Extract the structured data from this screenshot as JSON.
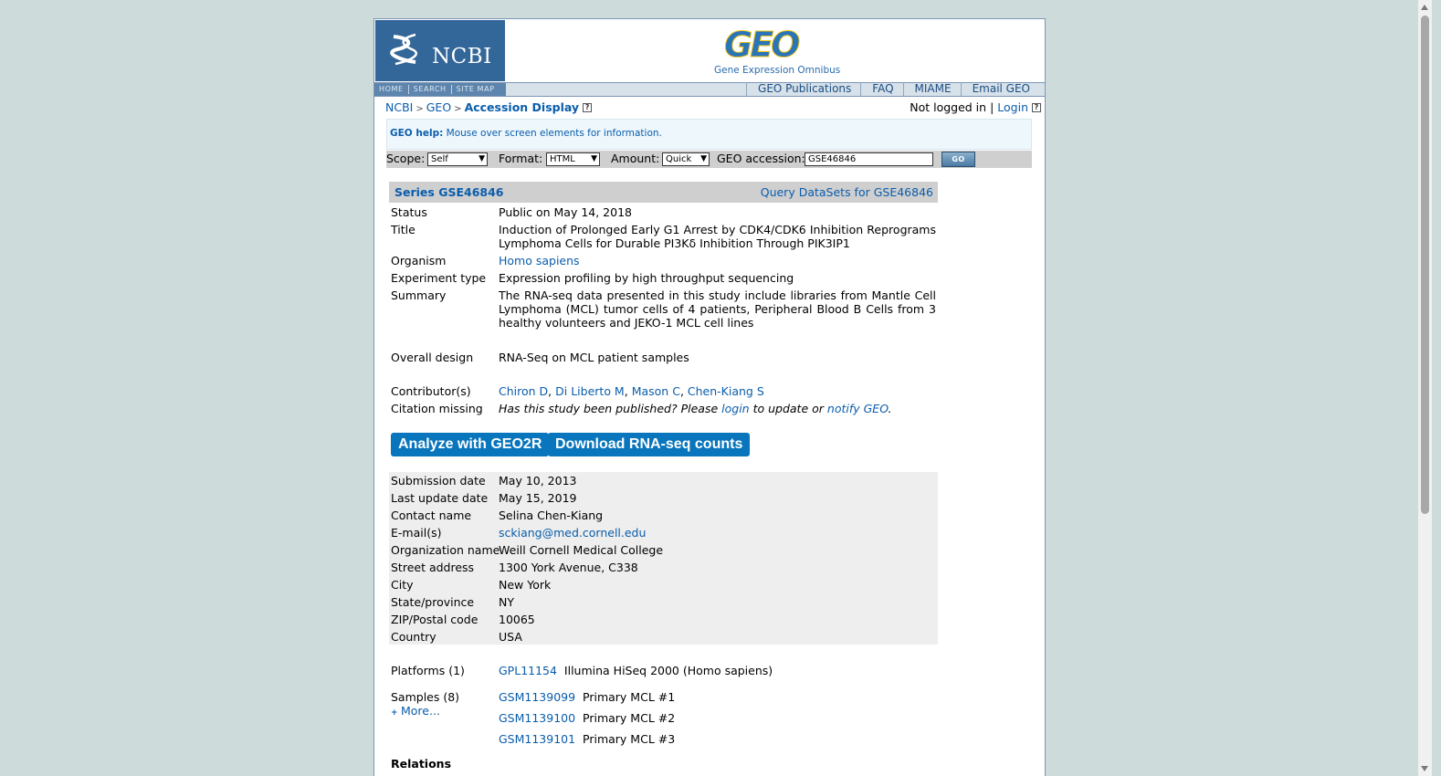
{
  "header": {
    "ncbi_logo_text": "NCBI",
    "geo_logo_text": "GEO",
    "geo_subtitle": "Gene Expression Omnibus",
    "ncbi_nav": [
      "HOME",
      "SEARCH",
      "SITE MAP"
    ],
    "geo_nav": [
      "GEO Publications",
      "FAQ",
      "MIAME",
      "Email GEO"
    ]
  },
  "breadcrumb": {
    "items": [
      "NCBI",
      "GEO"
    ],
    "current": "Accession Display",
    "sep": ">"
  },
  "login": {
    "status": "Not logged in",
    "separator": "|",
    "link": "Login"
  },
  "help": {
    "label": "GEO help:",
    "text": "Mouse over screen elements for information."
  },
  "query": {
    "scope_label": "Scope:",
    "scope_value": "Self",
    "format_label": "Format:",
    "format_value": "HTML",
    "amount_label": "Amount:",
    "amount_value": "Quick",
    "accession_label": "GEO accession:",
    "accession_value": "GSE46846",
    "go_label": "GO"
  },
  "series": {
    "title": "Series GSE46846",
    "query_link": "Query DataSets for GSE46846",
    "status_label": "Status",
    "status_value": "Public on May 14, 2018",
    "title_label": "Title",
    "title_value": "Induction of Prolonged Early G1 Arrest by CDK4/CDK6 Inhibition Reprograms Lymphoma Cells for Durable PI3Kδ Inhibition Through PIK3IP1",
    "organism_label": "Organism",
    "organism_value": "Homo sapiens",
    "exptype_label": "Experiment type",
    "exptype_value": "Expression profiling by high throughput sequencing",
    "summary_label": "Summary",
    "summary_value": "The RNA-seq data presented in this study include libraries from Mantle Cell Lymphoma (MCL) tumor cells of 4 patients, Peripheral Blood B Cells from 3 healthy volunteers and JEKO-1 MCL cell lines",
    "design_label": "Overall design",
    "design_value": "RNA-Seq on MCL patient samples",
    "contrib_label": "Contributor(s)",
    "contributors": [
      "Chiron D",
      "Di Liberto M",
      "Mason C",
      "Chen-Kiang S"
    ],
    "contrib_sep": ",",
    "citation_label": "Citation missing",
    "citation_text1": "Has this study been published? Please",
    "citation_login": "login",
    "citation_text2": "to update or",
    "citation_notify": "notify GEO",
    "citation_end": "."
  },
  "buttons": {
    "geo2r": "Analyze with GEO2R",
    "download": "Download RNA-seq counts"
  },
  "contact": {
    "submission_label": "Submission date",
    "submission_value": "May 10, 2013",
    "update_label": "Last update date",
    "update_value": "May 15, 2019",
    "name_label": "Contact name",
    "name_value": "Selina Chen-Kiang",
    "email_label": "E-mail(s)",
    "email_value": "sckiang@med.cornell.edu",
    "org_label": "Organization name",
    "org_value": "Weill Cornell Medical College",
    "street_label": "Street address",
    "street_value": "1300 York Avenue, C338",
    "city_label": "City",
    "city_value": "New York",
    "state_label": "State/province",
    "state_value": "NY",
    "zip_label": "ZIP/Postal code",
    "zip_value": "10065",
    "country_label": "Country",
    "country_value": "USA"
  },
  "platforms": {
    "label": "Platforms (1)",
    "items": [
      {
        "id": "GPL11154",
        "desc": "Illumina HiSeq 2000 (Homo sapiens)"
      }
    ]
  },
  "samples": {
    "label": "Samples (8)",
    "more": "More...",
    "items": [
      {
        "id": "GSM1139099",
        "desc": "Primary MCL #1"
      },
      {
        "id": "GSM1139100",
        "desc": "Primary MCL #2"
      },
      {
        "id": "GSM1139101",
        "desc": "Primary MCL #3"
      }
    ]
  },
  "relations": {
    "label": "Relations"
  }
}
